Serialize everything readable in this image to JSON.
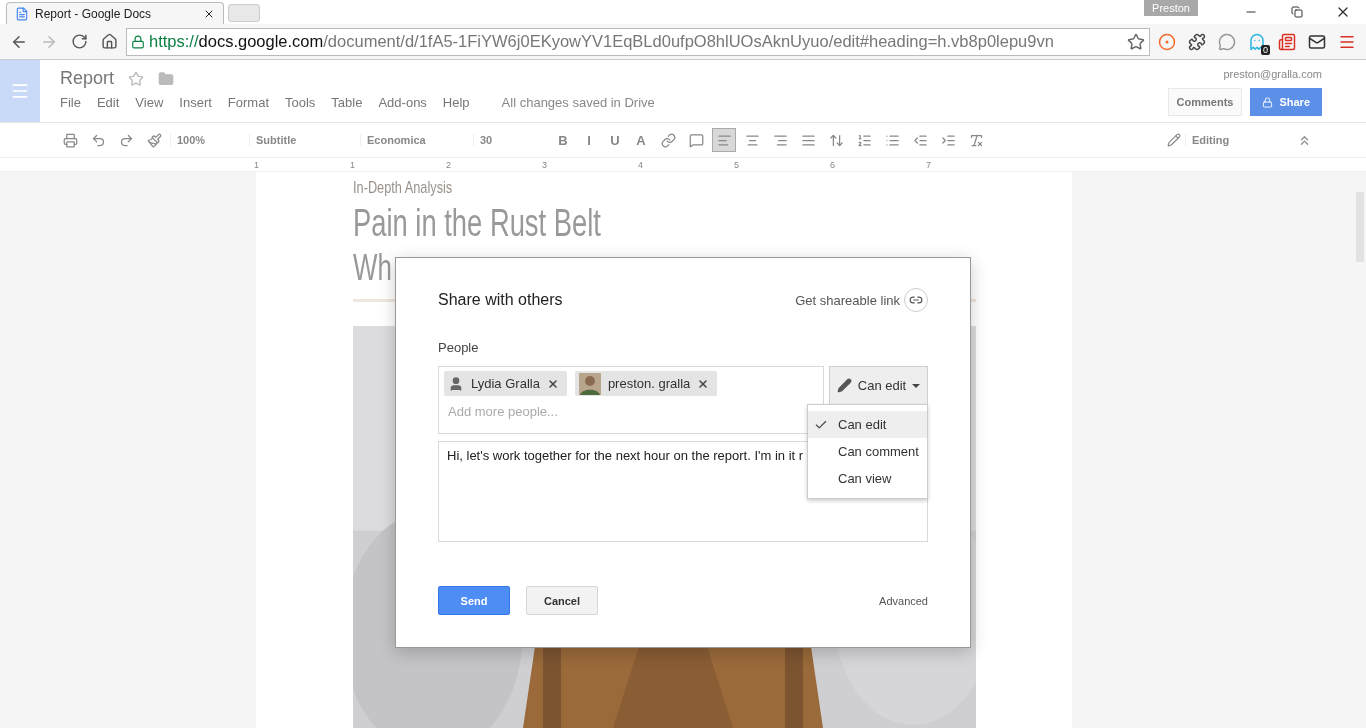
{
  "browser": {
    "tab_title": "Report - Google Docs",
    "profile": "Preston",
    "url_scheme": "https://",
    "url_host": "docs.google.com",
    "url_path": "/document/d/1fA5-1FiYW6j0EKyowYV1EqBLd0ufpO8hlUOsAknUyuo/edit#heading=h.vb8p0lepu9vn",
    "extension_badge": "0"
  },
  "docs": {
    "title": "Report",
    "menu": [
      "File",
      "Edit",
      "View",
      "Insert",
      "Format",
      "Tools",
      "Table",
      "Add-ons",
      "Help"
    ],
    "save_status": "All changes saved in Drive",
    "account": "preston@gralla.com",
    "comments_button": "Comments",
    "share_button": "Share"
  },
  "toolbar": {
    "zoom": "100%",
    "style": "Subtitle",
    "font": "Economica",
    "size": "30",
    "format_letters": [
      "B",
      "I",
      "U",
      "A"
    ],
    "alignment": [
      {
        "selected": true
      },
      {
        "selected": false
      },
      {
        "selected": false
      },
      {
        "selected": false
      }
    ],
    "mode": "Editing"
  },
  "ruler": [
    "1",
    "1",
    "2",
    "3",
    "4",
    "5",
    "6",
    "7"
  ],
  "document": {
    "kicker": "In-Depth Analysis",
    "title": "Pain in the Rust Belt",
    "subtitle": "Wh"
  },
  "dialog": {
    "title": "Share with others",
    "link": "Get shareable link",
    "people_label": "People",
    "chips": [
      {
        "name": "Lydia Gralla",
        "kind": "person"
      },
      {
        "name": "preston. gralla"
      }
    ],
    "add_placeholder": "Add more people...",
    "permission": "Can edit",
    "message": "Hi, let's work together for the next hour on the report. I'm in it r",
    "send": "Send",
    "cancel": "Cancel",
    "advanced": "Advanced",
    "permission_menu": [
      {
        "label": "Can edit",
        "selected": true
      },
      {
        "label": "Can comment",
        "selected": false
      },
      {
        "label": "Can view",
        "selected": false
      }
    ]
  }
}
